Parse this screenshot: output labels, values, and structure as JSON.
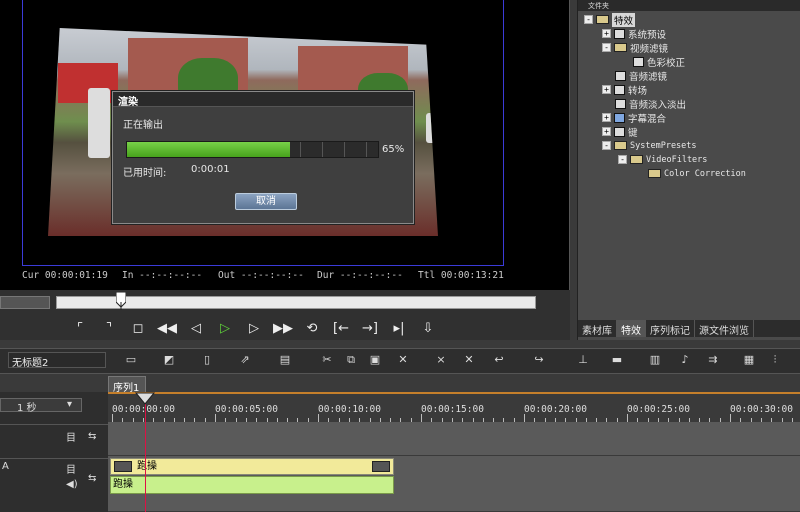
{
  "preview": {
    "timecodes": {
      "cur": "Cur 00:00:01:19",
      "in": "In --:--:--:--",
      "out": "Out --:--:--:--",
      "dur": "Dur --:--:--:--",
      "ttl": "Ttl 00:00:13:21"
    }
  },
  "render_dialog": {
    "title": "渲染",
    "status": "正在输出",
    "progress": 0.65,
    "progress_label": "65%",
    "elapsed_label": "已用时间:",
    "elapsed_value": "0:00:01",
    "cancel_label": "取消"
  },
  "right_panel": {
    "title": "文件夹",
    "tree": [
      {
        "label": "特效",
        "toggle": "-",
        "selected": true
      },
      {
        "label": "系统预设",
        "toggle": "+"
      },
      {
        "label": "视频滤镜",
        "toggle": "-"
      },
      {
        "label": "色彩校正",
        "toggle": ""
      },
      {
        "label": "音频滤镜",
        "toggle": ""
      },
      {
        "label": "转场",
        "toggle": "+"
      },
      {
        "label": "音频淡入淡出",
        "toggle": ""
      },
      {
        "label": "字幕混合",
        "toggle": "+"
      },
      {
        "label": "键",
        "toggle": "+"
      },
      {
        "label": "SystemPresets",
        "toggle": "-"
      },
      {
        "label": "VideoFilters",
        "toggle": "-"
      },
      {
        "label": "Color Correction",
        "toggle": ""
      }
    ],
    "tabs": [
      "素材库",
      "特效",
      "序列标记",
      "源文件浏览"
    ],
    "active_tab": 1
  },
  "timeline": {
    "project_name": "无标题2",
    "sequence_tab": "序列1",
    "zoom_label": "1 秒",
    "ruler_labels": [
      "00:00:00:00",
      "00:00:05:00",
      "00:00:10:00",
      "00:00:15:00",
      "00:00:20:00",
      "00:00:25:00",
      "00:00:30:00"
    ],
    "video_clip_label": "跑操",
    "audio_clip_label": "跑操",
    "track_a_label": "A"
  },
  "colors": {
    "progress": "#5fbf33",
    "ruler_accent": "#c57f2b",
    "video_clip": "#f2ea9a",
    "audio_clip": "#c8f08c",
    "cursor": "#dd1144"
  }
}
